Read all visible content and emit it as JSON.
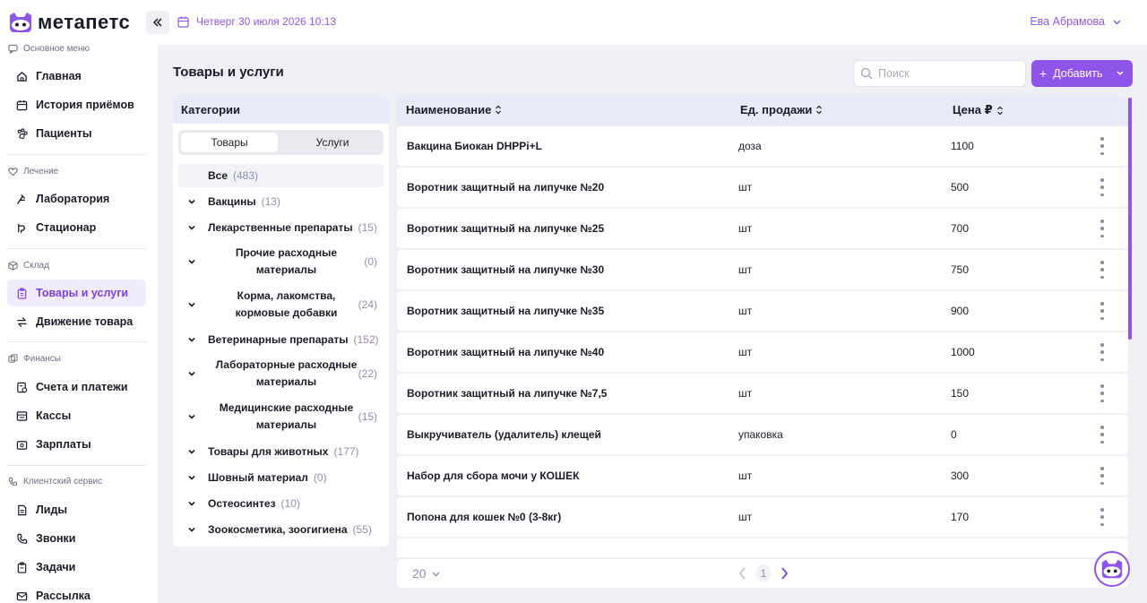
{
  "app": {
    "logo_text": "метапетс"
  },
  "header": {
    "date": "Четверг 30 июля 2026 10:13",
    "user": "Ева Абрамова"
  },
  "sidebar": {
    "sections": [
      {
        "title": "Основное меню",
        "items": [
          {
            "label": "Главная",
            "icon": "home-icon"
          },
          {
            "label": "История приёмов",
            "icon": "calendar-history-icon"
          },
          {
            "label": "Пациенты",
            "icon": "paw-icon"
          }
        ]
      },
      {
        "title": "Лечение",
        "items": [
          {
            "label": "Лаборатория",
            "icon": "flask-icon"
          },
          {
            "label": "Стационар",
            "icon": "hospital-icon"
          }
        ]
      },
      {
        "title": "Склад",
        "items": [
          {
            "label": "Товары и услуги",
            "icon": "clipboard-icon",
            "active": true
          },
          {
            "label": "Движение товара",
            "icon": "swap-icon"
          }
        ]
      },
      {
        "title": "Финансы",
        "items": [
          {
            "label": "Счета и платежи",
            "icon": "invoice-icon"
          },
          {
            "label": "Кассы",
            "icon": "cash-register-icon"
          },
          {
            "label": "Зарплаты",
            "icon": "wallet-icon"
          }
        ]
      },
      {
        "title": "Клиентский сервис",
        "items": [
          {
            "label": "Лиды",
            "icon": "document-icon"
          },
          {
            "label": "Звонки",
            "icon": "phone-icon"
          },
          {
            "label": "Задачи",
            "icon": "task-icon"
          },
          {
            "label": "Рассылка",
            "icon": "mail-icon"
          }
        ]
      }
    ]
  },
  "page": {
    "title": "Товары и услуги",
    "search_placeholder": "Поиск",
    "add_label": "Добавить"
  },
  "categories": {
    "title": "Категории",
    "tabs": [
      "Товары",
      "Услуги"
    ],
    "all": {
      "label": "Все",
      "count": "(483)"
    },
    "items": [
      {
        "label": "Вакцины",
        "count": "(13)"
      },
      {
        "label": "Лекарственные препараты",
        "count": "(15)"
      },
      {
        "label": "Прочие расходные материалы",
        "lines": [
          "Прочие расходные",
          "материалы"
        ],
        "count": "(0)"
      },
      {
        "label": "Корма, лакомства, кормовые добавки",
        "lines": [
          "Корма, лакомства,",
          "кормовые добавки"
        ],
        "count": "(24)"
      },
      {
        "label": "Ветеринарные препараты",
        "count": "(152)"
      },
      {
        "label": "Лабораторные расходные материалы",
        "lines": [
          "Лабораторные расходные",
          "материалы"
        ],
        "count": "(22)"
      },
      {
        "label": "Медицинские расходные материалы",
        "lines": [
          "Медицинские расходные",
          "материалы"
        ],
        "count": "(15)"
      },
      {
        "label": "Товары для животных",
        "count": "(177)"
      },
      {
        "label": "Шовный материал",
        "count": "(0)"
      },
      {
        "label": "Остеосинтез",
        "count": "(10)"
      },
      {
        "label": "Зоокосметика, зоогигиена",
        "count": "(55)"
      }
    ]
  },
  "table": {
    "columns": [
      "Наименование",
      "Ед. продажи",
      "Цена ₽"
    ],
    "rows": [
      {
        "name": "Вакцина Биокан DHPPi+L",
        "unit": "доза",
        "price": "1100"
      },
      {
        "name": "Воротник защитный на липучке №20",
        "unit": "шт",
        "price": "500"
      },
      {
        "name": "Воротник защитный на липучке №25",
        "unit": "шт",
        "price": "700"
      },
      {
        "name": "Воротник защитный на липучке №30",
        "unit": "шт",
        "price": "750"
      },
      {
        "name": "Воротник защитный на липучке №35",
        "unit": "шт",
        "price": "900"
      },
      {
        "name": "Воротник защитный на липучке №40",
        "unit": "шт",
        "price": "1000"
      },
      {
        "name": "Воротник защитный на липучке №7,5",
        "unit": "шт",
        "price": "150"
      },
      {
        "name": "Выкручиватель (удалитель) клещей",
        "unit": "упаковка",
        "price": "0"
      },
      {
        "name": "Набор для сбора мочи у КОШЕК",
        "unit": "шт",
        "price": "300"
      },
      {
        "name": "Попона для кошек №0 (3-8кг)",
        "unit": "шт",
        "price": "170"
      }
    ]
  },
  "pager": {
    "per_page": "20",
    "current": "1"
  },
  "colors": {
    "accent": "#8f55ea",
    "header_bg": "#e9eaf9",
    "page_bg": "#eff0f5"
  }
}
